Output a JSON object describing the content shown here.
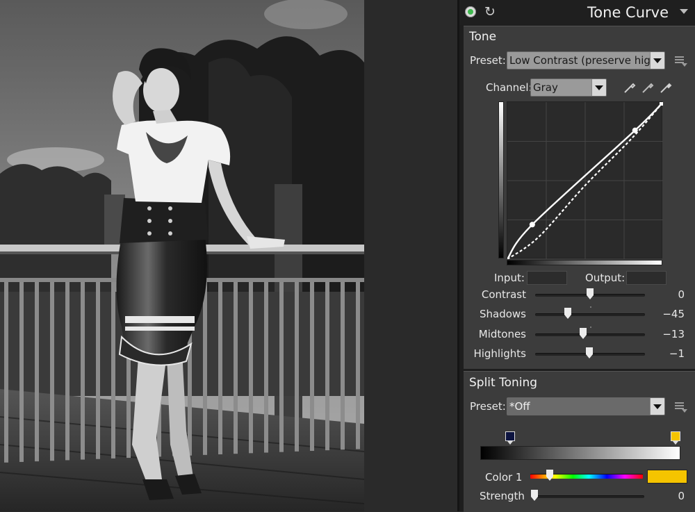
{
  "photo": {
    "alt_label": ""
  },
  "panel": {
    "title": "Tone Curve",
    "reset_glyph": "↻",
    "collapse_icon": "triangle-down-icon"
  },
  "tone": {
    "section_title": "Tone",
    "preset_label": "Preset:",
    "preset_value": "Low Contrast (preserve highlights)",
    "channel_label": "Channel:",
    "channel_value": "Gray",
    "pickers": [
      "eyedropper-black-icon",
      "eyedropper-gray-icon",
      "eyedropper-white-icon"
    ],
    "input_label": "Input:",
    "output_label": "Output:",
    "input_value": "",
    "output_value": "",
    "curve": {
      "control_points": [
        [
          0.0,
          0.0
        ],
        [
          0.16,
          0.22
        ],
        [
          0.82,
          0.82
        ],
        [
          1.0,
          1.0
        ]
      ],
      "reference_points": [
        [
          0.0,
          0.0
        ],
        [
          0.2,
          0.14
        ],
        [
          0.5,
          0.47
        ],
        [
          0.8,
          0.77
        ],
        [
          1.0,
          1.0
        ]
      ]
    },
    "sliders": [
      {
        "label": "Contrast",
        "value": "0",
        "position": 0.5
      },
      {
        "label": "Shadows",
        "value": "−45",
        "position": 0.295,
        "default_marker": 0.5
      },
      {
        "label": "Midtones",
        "value": "−13",
        "position": 0.435,
        "default_marker": 0.5
      },
      {
        "label": "Highlights",
        "value": "−1",
        "position": 0.495
      }
    ]
  },
  "split": {
    "section_title": "Split Toning",
    "preset_label": "Preset:",
    "preset_value": "*Off",
    "shadow_color": "#0d1440",
    "highlight_color": "#f5c400",
    "shadow_marker_position": 0.15,
    "highlight_marker_position": 1.0,
    "color1_label": "Color 1",
    "color1_hue_position": 0.17,
    "color1_swatch": "#f5c400",
    "strength_label": "Strength",
    "strength_value": "0",
    "strength_position": 0.0
  },
  "colors": {
    "accent_power": "#3fb94e"
  }
}
